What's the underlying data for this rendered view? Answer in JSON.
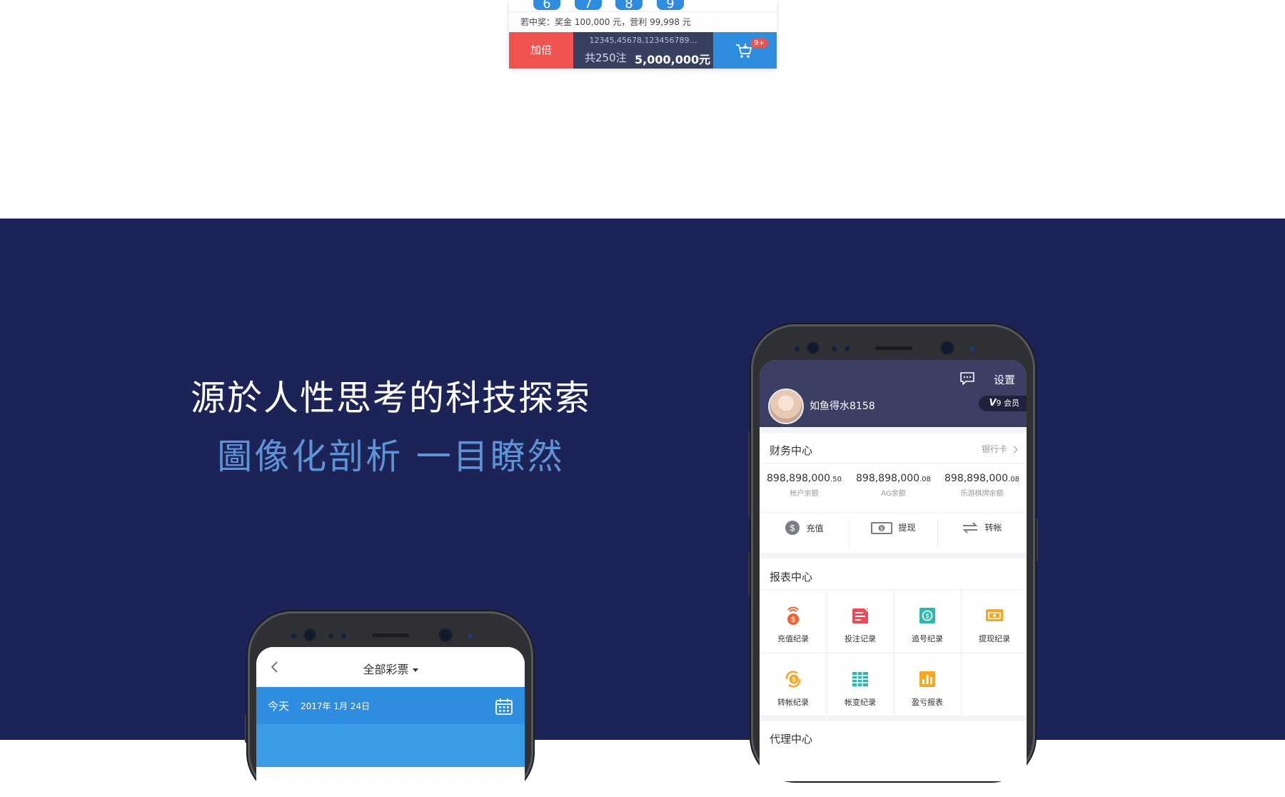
{
  "betting": {
    "balls": [
      "6",
      "7",
      "8",
      "9"
    ],
    "prize_text": "若中奖：奖金 100,000 元，营利 99,998 元",
    "double_label": "加倍",
    "bet_numbers": "12345,45678,123456789…",
    "bet_count": "共250注",
    "bet_amount": "5,000,000元",
    "cart_badge": "9+"
  },
  "headline": {
    "title": "源於人性思考的科技探索",
    "subtitle": "圖像化剖析 一目瞭然"
  },
  "left_phone": {
    "title": "全部彩票",
    "today_label": "今天",
    "date": "2017年 1月 24日"
  },
  "right_phone": {
    "settings_label": "设置",
    "username": "如鱼得水8158",
    "vip_level": "V",
    "vip_num": "9",
    "vip_label": "会员",
    "finance_title": "财务中心",
    "bank_card_label": "银行卡",
    "balances": [
      {
        "main": "898,898,000",
        "decimal": ".50",
        "label": "帐户余额"
      },
      {
        "main": "898,898,000",
        "decimal": ".08",
        "label": "AG余额"
      },
      {
        "main": "898,898,000",
        "decimal": ".08",
        "label": "乐游棋牌余额"
      }
    ],
    "actions": [
      {
        "label": "充值",
        "icon": "dollar-coin-icon"
      },
      {
        "label": "提现",
        "icon": "banknote-icon"
      },
      {
        "label": "转帐",
        "icon": "transfer-arrows-icon"
      }
    ],
    "report_title": "报表中心",
    "reports": [
      {
        "label": "充值纪录",
        "icon": "deposit-record-icon",
        "color": "#f2612e"
      },
      {
        "label": "投注记录",
        "icon": "bet-record-icon",
        "color": "#ea4a5a"
      },
      {
        "label": "追号纪录",
        "icon": "chase-record-icon",
        "color": "#2bb6b0"
      },
      {
        "label": "提现纪录",
        "icon": "withdraw-record-icon",
        "color": "#f5a623"
      },
      {
        "label": "转帐纪录",
        "icon": "transfer-record-icon",
        "color": "#f5a623"
      },
      {
        "label": "帐变纪录",
        "icon": "ledger-record-icon",
        "color": "#2bb6b0"
      },
      {
        "label": "盈亏报表",
        "icon": "profit-report-icon",
        "color": "#f5a623"
      }
    ],
    "agent_title": "代理中心"
  },
  "colors": {
    "dark_bg": "#1c2356",
    "accent_blue": "#2f8de0",
    "accent_red": "#ef5350",
    "headline_sub": "#5f93d6"
  }
}
